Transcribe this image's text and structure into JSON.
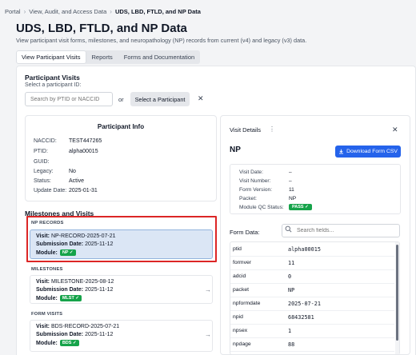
{
  "breadcrumb": [
    "Portal",
    "View, Audit, and Access Data",
    "UDS, LBD, FTLD, and NP Data"
  ],
  "page": {
    "title": "UDS, LBD, FTLD, and NP Data",
    "subtitle": "View participant visit forms, milestones, and neuropathology (NP) records from current (v4) and legacy (v3) data."
  },
  "tabs": [
    "View Participant Visits",
    "Reports",
    "Forms and Documentation"
  ],
  "participant_visits": {
    "title": "Participant Visits",
    "subtitle": "Select a participant ID:",
    "search_placeholder": "Search by PTID or NACCID",
    "or_label": "or",
    "select_button": "Select a Participant",
    "clear_icon": "✕"
  },
  "participant_info": {
    "title": "Participant Info",
    "fields": [
      {
        "label": "NACCID:",
        "value": "TEST447265"
      },
      {
        "label": "PTID:",
        "value": "alpha00015"
      },
      {
        "label": "GUID:",
        "value": ""
      },
      {
        "label": "Legacy:",
        "value": "No"
      },
      {
        "label": "Status:",
        "value": "Active"
      },
      {
        "label": "Update Date:",
        "value": "2025-01-31"
      }
    ]
  },
  "milestones": {
    "title": "Milestones and Visits",
    "sections": [
      {
        "label": "NP RECORDS",
        "visit_label": "Visit:",
        "visit": "NP-RECORD-2025-07-21",
        "submission_label": "Submission Date:",
        "submission": "2025-11-12",
        "module_label": "Module:",
        "module": "NP ✓"
      },
      {
        "label": "MILESTONES",
        "visit_label": "Visit:",
        "visit": "MILESTONE-2025-08-12",
        "submission_label": "Submission Date:",
        "submission": "2025-11-12",
        "module_label": "Module:",
        "module": "MLST ✓"
      },
      {
        "label": "FORM VISITS",
        "visit_label": "Visit:",
        "visit": "BDS-RECORD-2025-07-21",
        "submission_label": "Submission Date:",
        "submission": "2025-11-12",
        "module_label": "Module:",
        "module": "BDS ✓"
      }
    ]
  },
  "visit_details": {
    "title": "Visit Details",
    "heading": "NP",
    "download_button": "Download Form CSV",
    "fields": [
      {
        "label": "Visit Date:",
        "value": "–"
      },
      {
        "label": "Visit Number:",
        "value": "–"
      },
      {
        "label": "Form Version:",
        "value": "11"
      },
      {
        "label": "Packet:",
        "value": "NP"
      },
      {
        "label": "Module QC Status:",
        "value": "PASS ✓"
      }
    ],
    "form_data_label": "Form Data:",
    "search_placeholder": "Search fields...",
    "form_data": [
      {
        "key": "ptid",
        "value": "alpha00015"
      },
      {
        "key": "formver",
        "value": "11"
      },
      {
        "key": "adcid",
        "value": "0"
      },
      {
        "key": "packet",
        "value": "NP"
      },
      {
        "key": "npformdate",
        "value": "2025-07-21"
      },
      {
        "key": "npid",
        "value": "68432581"
      },
      {
        "key": "npsex",
        "value": "1"
      },
      {
        "key": "npdage",
        "value": "88"
      }
    ]
  },
  "colors": {
    "accent": "#2563eb",
    "pass": "#16a34a",
    "highlight": "#dc2626",
    "selected_bg": "#dbe6f5"
  }
}
